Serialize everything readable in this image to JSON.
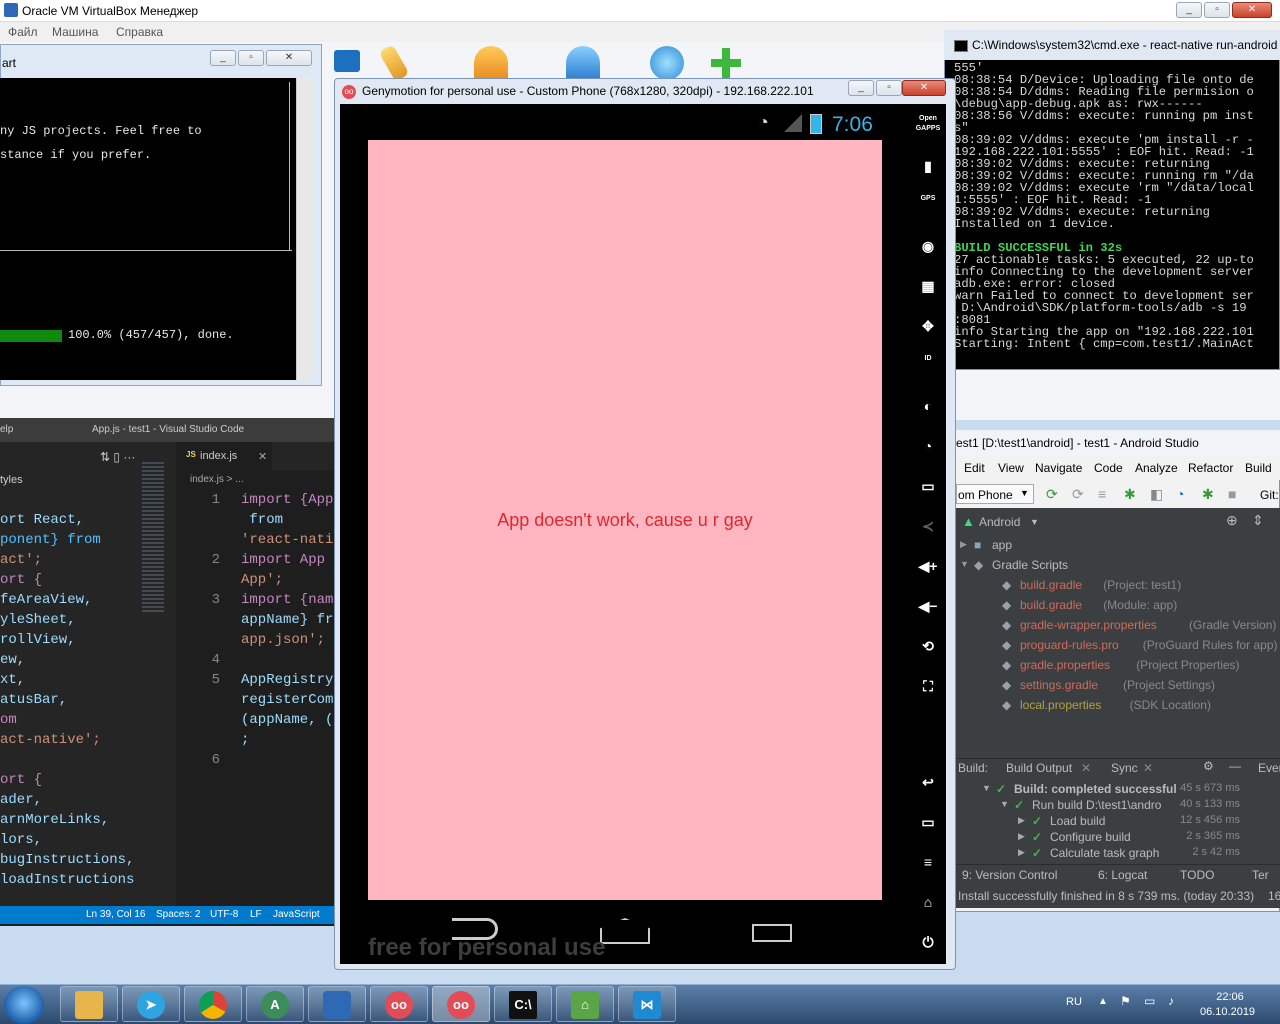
{
  "vbox": {
    "title": "Oracle VM VirtualBox Менеджер",
    "menu": [
      "Файл",
      "Машина",
      "Справка"
    ]
  },
  "left_console": {
    "title_fragment": "art",
    "lines": [
      "ny JS projects. Feel free to",
      "stance if you prefer."
    ],
    "progress_text": "100.0% (457/457), done."
  },
  "vscode": {
    "title": "App.js - test1 - Visual Studio Code",
    "menu_fragment": "elp",
    "tab_label": "index.js",
    "breadcrumb": "index.js > ...",
    "sidebar_header": "tyles",
    "sidebar_code": [
      "ort React,",
      "ponent} from",
      "act';",
      "ort {",
      "feAreaView,",
      "yleSheet,",
      "rollView,",
      "ew,",
      "xt,",
      "atusBar,",
      "om",
      "act-native';",
      "",
      "ort {",
      "ader,",
      "arnMoreLinks,",
      "lors,",
      "bugInstructions,",
      "loadInstructions"
    ],
    "line_numbers": [
      "1",
      "",
      "",
      "2",
      "",
      "3",
      "",
      "",
      "4",
      "5",
      "",
      "",
      "",
      "6"
    ],
    "editor_code": [
      "import {App",
      " from",
      "'react-nati",
      "import App",
      "App';",
      "import {nam",
      "appName} fr",
      "app.json';",
      "",
      "AppRegistry",
      "registerCom",
      "(appName, (",
      ";",
      ""
    ],
    "status": {
      "position": "Ln 39, Col 16",
      "spaces": "Spaces: 2",
      "encoding": "UTF-8",
      "eol": "LF",
      "language": "JavaScript"
    }
  },
  "genymotion": {
    "title": "Genymotion for personal use - Custom Phone (768x1280, 320dpi) - 192.168.222.101",
    "clock": "7:06",
    "app_message": "App doesn't work, cause u r gay",
    "watermark": "free for personal use",
    "side_icons": [
      "open-gapps-icon",
      "battery-icon",
      "gps-icon",
      "camera-icon",
      "media-icon",
      "dpad-icon",
      "id-icon",
      "disk-icon",
      "rss-icon",
      "sms-icon",
      "share-icon",
      "volume-up-icon",
      "volume-down-icon",
      "rotate-icon",
      "scale-icon",
      "back-icon",
      "recent-icon",
      "menu-icon",
      "home-icon",
      "power-icon"
    ],
    "side_labels": {
      "open_gapps": "Open GAPPS",
      "gps": "GPS",
      "id": "ID"
    }
  },
  "cmd": {
    "title": "C:\\Windows\\system32\\cmd.exe - react-native  run-android",
    "lines": [
      {
        "text": "555'",
        "color": "#d8d8d8"
      },
      {
        "text": "08:38:54 D/Device: Uploading file onto de",
        "color": "#d8d8d8"
      },
      {
        "text": "08:38:54 D/ddms: Reading file permision o",
        "color": "#d8d8d8"
      },
      {
        "text": "\\debug\\app-debug.apk as: rwx------",
        "color": "#d8d8d8"
      },
      {
        "text": "08:38:56 V/ddms: execute: running pm inst",
        "color": "#d8d8d8"
      },
      {
        "text": "s\"",
        "color": "#d8d8d8"
      },
      {
        "text": "08:39:02 V/ddms: execute 'pm install -r -",
        "color": "#d8d8d8"
      },
      {
        "text": "192.168.222.101:5555' : EOF hit. Read: -1",
        "color": "#d8d8d8"
      },
      {
        "text": "08:39:02 V/ddms: execute: returning",
        "color": "#d8d8d8"
      },
      {
        "text": "08:39:02 V/ddms: execute: running rm \"/da",
        "color": "#d8d8d8"
      },
      {
        "text": "08:39:02 V/ddms: execute 'rm \"/data/local",
        "color": "#d8d8d8"
      },
      {
        "text": "1:5555' : EOF hit. Read: -1",
        "color": "#d8d8d8"
      },
      {
        "text": "08:39:02 V/ddms: execute: returning",
        "color": "#d8d8d8"
      },
      {
        "text": "Installed on 1 device.",
        "color": "#d8d8d8"
      },
      {
        "text": "",
        "color": "#d8d8d8"
      },
      {
        "text": "BUILD SUCCESSFUL in 32s",
        "color": "#3fd64f"
      },
      {
        "text": "27 actionable tasks: 5 executed, 22 up-to",
        "color": "#d8d8d8"
      },
      {
        "text": "info Connecting to the development server",
        "color": "#d8d8d8"
      },
      {
        "text": "adb.exe: error: closed",
        "color": "#d8d8d8"
      },
      {
        "text": "warn Failed to connect to development ser",
        "color": "#d8d8d8"
      },
      {
        "text": " D:\\Android\\SDK/platform-tools/adb -s 19",
        "color": "#d8d8d8"
      },
      {
        "text": ":8081",
        "color": "#d8d8d8"
      },
      {
        "text": "info Starting the app on \"192.168.222.101",
        "color": "#d8d8d8"
      },
      {
        "text": "Starting: Intent { cmp=com.test1/.MainAct",
        "color": "#d8d8d8"
      }
    ]
  },
  "android_studio": {
    "title": "est1 [D:\\test1\\android] - test1 - Android Studio",
    "menu": [
      "Edit",
      "View",
      "Navigate",
      "Code",
      "Analyze",
      "Refactor",
      "Build"
    ],
    "device": "om Phone",
    "git_label": "Git:",
    "project_view": "Android",
    "tree": [
      {
        "name": "app",
        "note": "",
        "level": 0,
        "kind": "folder"
      },
      {
        "name": "Gradle Scripts",
        "note": "",
        "level": 0,
        "kind": "group"
      },
      {
        "name": "build.gradle",
        "note": "(Project: test1)",
        "level": 1,
        "kind": "file"
      },
      {
        "name": "build.gradle",
        "note": "(Module: app)",
        "level": 1,
        "kind": "file"
      },
      {
        "name": "gradle-wrapper.properties",
        "note": "(Gradle Version)",
        "level": 1,
        "kind": "file"
      },
      {
        "name": "proguard-rules.pro",
        "note": "(ProGuard Rules for app)",
        "level": 1,
        "kind": "file"
      },
      {
        "name": "gradle.properties",
        "note": "(Project Properties)",
        "level": 1,
        "kind": "file"
      },
      {
        "name": "settings.gradle",
        "note": "(Project Settings)",
        "level": 1,
        "kind": "file"
      },
      {
        "name": "local.properties",
        "note": "(SDK Location)",
        "level": 1,
        "kind": "local"
      }
    ],
    "build_tabs": {
      "label": "Build:",
      "output": "Build Output",
      "sync": "Sync",
      "events": "Even"
    },
    "build_rows": [
      {
        "label": "Build: completed successful",
        "time": "45 s 673 ms",
        "level": 0
      },
      {
        "label": "Run build D:\\test1\\andro",
        "time": "40 s 133 ms",
        "level": 1
      },
      {
        "label": "Load build",
        "time": "12 s 456 ms",
        "level": 2
      },
      {
        "label": "Configure build",
        "time": "2 s 365 ms",
        "level": 2
      },
      {
        "label": "Calculate task graph",
        "time": "2 s 42 ms",
        "level": 2
      }
    ],
    "bottom_tabs": [
      "9: Version Control",
      "6: Logcat",
      "TODO",
      "Ter"
    ],
    "status": "Install successfully finished in 8 s 739 ms. (today 20:33)",
    "status_col": "16"
  },
  "taskbar": {
    "lang": "RU",
    "time": "22:06",
    "date": "06.10.2019"
  }
}
